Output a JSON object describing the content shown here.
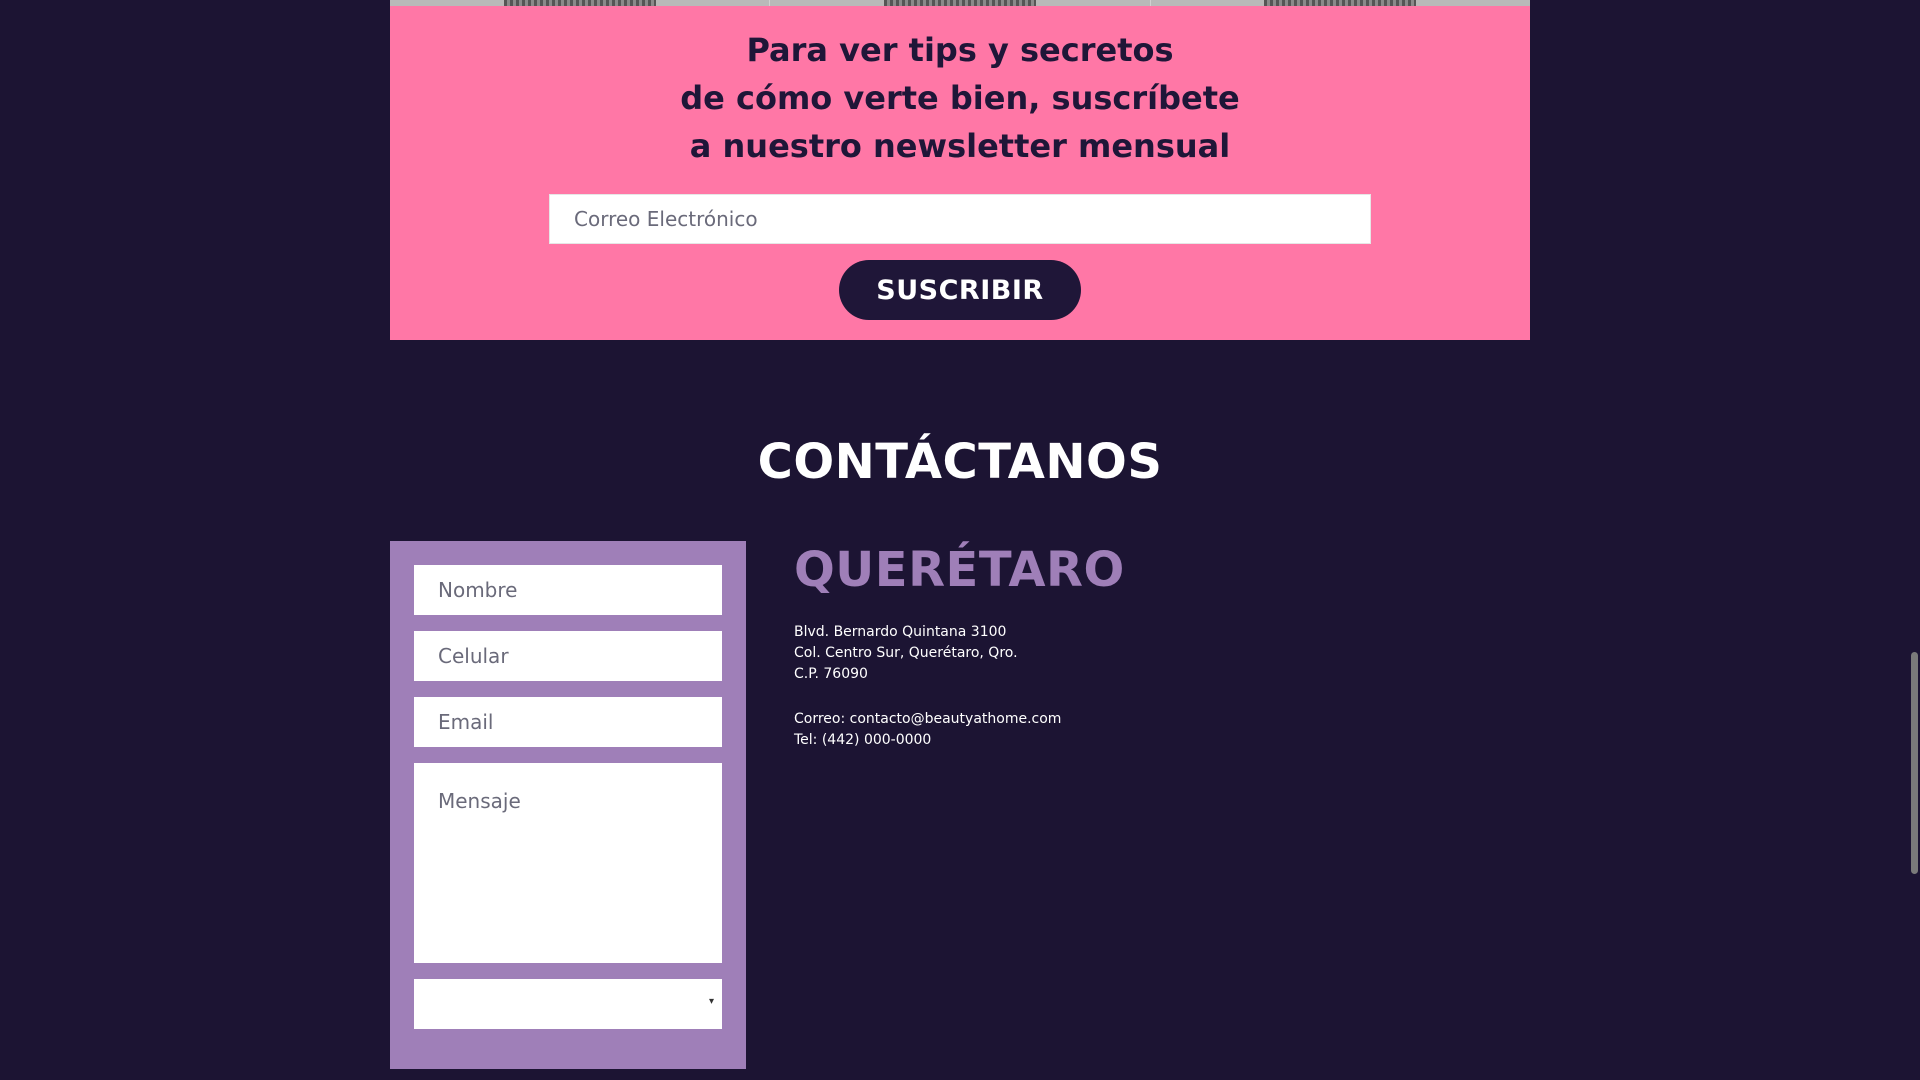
{
  "newsletter": {
    "heading_lines": [
      "Para ver tips y secretos",
      "de cómo verte bien, suscríbete",
      "a nuestro newsletter mensual"
    ],
    "email_placeholder": "Correo Electrónico",
    "subscribe_label": "SUSCRIBIR"
  },
  "contact": {
    "title": "CONTÁCTANOS",
    "form": {
      "name_placeholder": "Nombre",
      "phone_placeholder": "Celular",
      "email_placeholder": "Email",
      "message_placeholder": "Mensaje",
      "select_value": "",
      "select_caret": "▾"
    },
    "location": {
      "city": "QUERÉTARO",
      "address_lines": [
        "Blvd. Bernardo Quintana 3100",
        "Col. Centro Sur, Querétaro, Qro.",
        "C.P. 76090"
      ],
      "email_line": "Correo: contacto@beautyathome.com",
      "phone_line": "Tel: (442) 000-0000"
    }
  },
  "colors": {
    "background": "#1c1433",
    "newsletter_bg": "#ff77a6",
    "accent_purple": "#9f7fb8",
    "dark_navy": "#1f1638"
  }
}
